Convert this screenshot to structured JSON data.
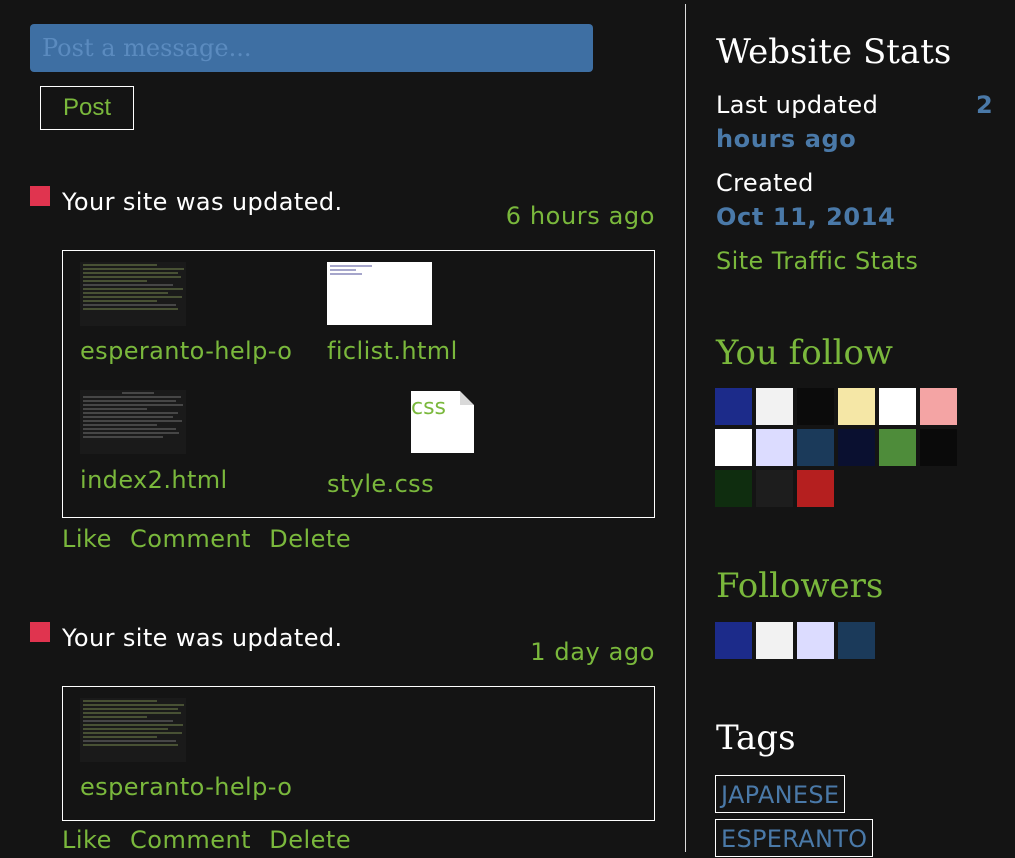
{
  "composer": {
    "placeholder": "Post a message...",
    "post_label": "Post"
  },
  "feed": [
    {
      "text": "Your site was updated.",
      "time": "6 hours ago",
      "files": [
        {
          "name": "esperanto-help-o",
          "thumb": "dark-text"
        },
        {
          "name": "ficlist.html",
          "thumb": "white"
        },
        {
          "name": "index2.html",
          "thumb": "dark-text"
        },
        {
          "name": "style.css",
          "thumb": "css-icon",
          "icon_label": "css"
        }
      ],
      "actions": [
        "Like",
        "Comment",
        "Delete"
      ]
    },
    {
      "text": "Your site was updated.",
      "time": "1 day ago",
      "files": [
        {
          "name": "esperanto-help-o",
          "thumb": "dark-text"
        }
      ],
      "actions": [
        "Like",
        "Comment",
        "Delete"
      ]
    }
  ],
  "stats": {
    "heading": "Website Stats",
    "last_updated_label": "Last updated",
    "last_updated_num": "2",
    "last_updated_unit": "hours ago",
    "created_label": "Created",
    "created_value": "Oct 11, 2014",
    "traffic_link": "Site Traffic Stats"
  },
  "you_follow": {
    "heading": "You follow",
    "thumbs": [
      "#1c2b8a",
      "#f2f2f2",
      "#0b0b0b",
      "#f5e7a6",
      "#ffffff",
      "#f4a4a4",
      "#ffffff",
      "#dcdcff",
      "#1b3a5a",
      "#0a1030",
      "#4e8c3a",
      "#0a0a0a",
      "#0f2d0f",
      "#1d1d1d",
      "#b51f1f"
    ]
  },
  "followers": {
    "heading": "Followers",
    "thumbs": [
      "#1c2b8a",
      "#f2f2f2",
      "#dcdcff",
      "#1b3a5a"
    ]
  },
  "tags": {
    "heading": "Tags",
    "items": [
      "JAPANESE",
      "ESPERANTO"
    ]
  },
  "colors": {
    "accent_green": "#7ab83c",
    "accent_blue": "#4a79a8",
    "event_marker": "#e0344f",
    "background": "#141414"
  }
}
